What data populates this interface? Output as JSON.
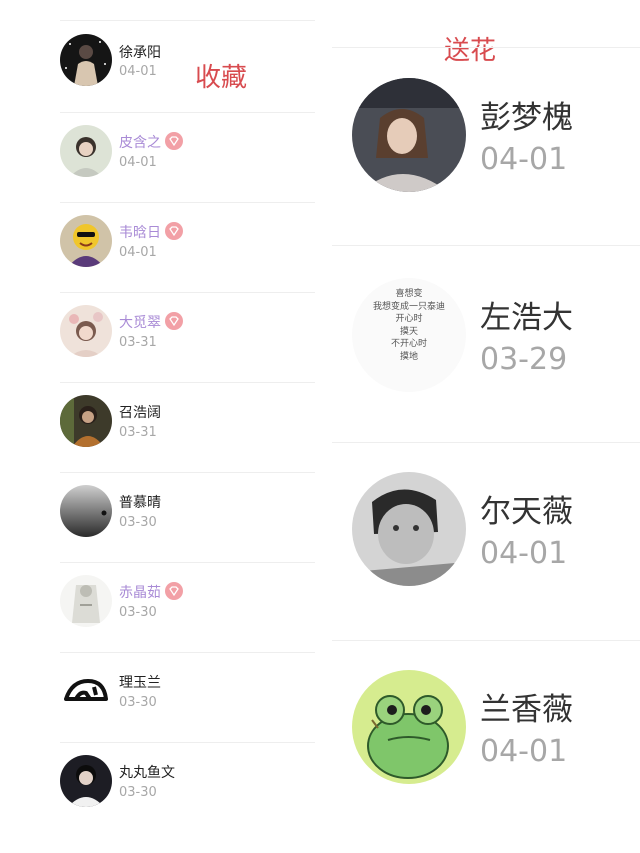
{
  "favorites": {
    "title": "收藏",
    "items": [
      {
        "name": "徐承阳",
        "date": "04-01",
        "vip": false
      },
      {
        "name": "皮含之",
        "date": "04-01",
        "vip": true
      },
      {
        "name": "韦晗日",
        "date": "04-01",
        "vip": true
      },
      {
        "name": "大觅翠",
        "date": "03-31",
        "vip": true
      },
      {
        "name": "召浩阔",
        "date": "03-31",
        "vip": false
      },
      {
        "name": "普慕晴",
        "date": "03-30",
        "vip": false
      },
      {
        "name": "赤晶茹",
        "date": "03-30",
        "vip": true
      },
      {
        "name": "理玉兰",
        "date": "03-30",
        "vip": false
      },
      {
        "name": "丸丸鱼文",
        "date": "03-30",
        "vip": false
      }
    ]
  },
  "flowers": {
    "title": "送花",
    "items": [
      {
        "name": "彭梦槐",
        "date": "04-01"
      },
      {
        "name": "左浩大",
        "date": "03-29",
        "avatar_text": [
          "喜想变",
          "我想变成一只泰迪",
          "开心时",
          "摸天",
          "不开心时",
          "摸地"
        ]
      },
      {
        "name": "尔天薇",
        "date": "04-01"
      },
      {
        "name": "兰香薇",
        "date": "04-01"
      }
    ]
  },
  "colors": {
    "accent_red": "#d84b4f",
    "vip_purple": "#a98bd6",
    "vip_badge": "#f2a0a6",
    "date_gray": "#a7a7a7"
  }
}
